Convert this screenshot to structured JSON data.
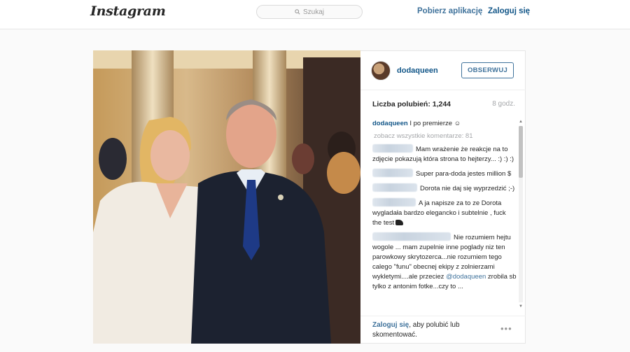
{
  "header": {
    "logo": "Instagram",
    "search_placeholder": "Szukaj",
    "get_app": "Pobierz aplikację",
    "login": "Zaloguj się"
  },
  "post": {
    "username": "dodaqueen",
    "follow_label": "OBSERWUJ",
    "likes": "Liczba polubień: 1,244",
    "time": "8 godz.",
    "caption_user": "dodaqueen",
    "caption_text": "I po premierze ☺",
    "see_all": "zobacz wszystkie komentarze: 81",
    "comments": [
      {
        "text": "Mam wrażenie że reakcje na to zdjęcie pokazują która strona to hejterzy... :) :) :)"
      },
      {
        "text": "Super para-doda jestes million $"
      },
      {
        "text": "Dorota nie daj się wyprzedzić ;-)"
      },
      {
        "text": "A ja napisze za to ze Dorota wygladała bardzo elegancko i subtelnie , fuck the test"
      },
      {
        "text_before": "Nie rozumiem hejtu wogole ... mam zupelnie inne poglady niz ten parowkowy skrytozerca...nie rozumiem tego calego \"funu\" obecnej ekipy z zolnierzami wykletymi....ale przeciez ",
        "mention": "@dodaqueen",
        "text_after": " zrobila sb tylko z antonim fotke...czy to ..."
      }
    ],
    "footer_link": "Zaloguj się",
    "footer_text": ", aby polubić lub skomentować.",
    "more": "•••"
  }
}
